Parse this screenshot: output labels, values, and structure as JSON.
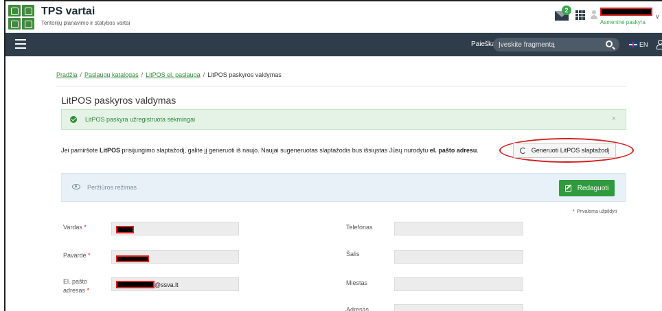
{
  "header": {
    "app_title": "TPS vartai",
    "app_subtitle": "Teritorijų planavimo ir statybos vartai",
    "notification_count": "2",
    "account_label": "Asmeninė paskyra"
  },
  "navbar": {
    "search_label": "Paieška",
    "search_placeholder": "Įveskite fragmentą",
    "language": "EN"
  },
  "breadcrumb": {
    "items": [
      "Pradžia",
      "Paslaugų katalogas",
      "LitPOS el. paslauga"
    ],
    "current": "LitPOS paskyros valdymas"
  },
  "page": {
    "title": "LitPOS paskyros valdymas",
    "success_message": "LitPOS paskyra užregistruota sėkmingai",
    "info_before": "Jei pamiršote ",
    "info_bold1": "LitPOS",
    "info_middle": " prisijungimo slaptažodį, galite jį generuoti iš naujo. Naujai sugeneruotas slaptažodis bus išsiųstas Jūsų nurodytu ",
    "info_bold2": "el. pašto adresu",
    "info_after": ".",
    "generate_button": "Generuoti LitPOS slaptažodį",
    "view_mode_label": "Peržiūros režimas",
    "edit_button": "Redaguoti",
    "required_note": "Privaloma užpildyti"
  },
  "form": {
    "left": {
      "first_name_label": "Vardas",
      "last_name_label": "Pavardė",
      "email_label_line1": "El. pašto",
      "email_label_line2": "adresas",
      "email_suffix": "@ssva.lt"
    },
    "right": {
      "phone_label": "Telefonas",
      "country_label": "Šalis",
      "city_label": "Miestas",
      "address_label": "Adresas"
    },
    "required_marker": "*"
  }
}
